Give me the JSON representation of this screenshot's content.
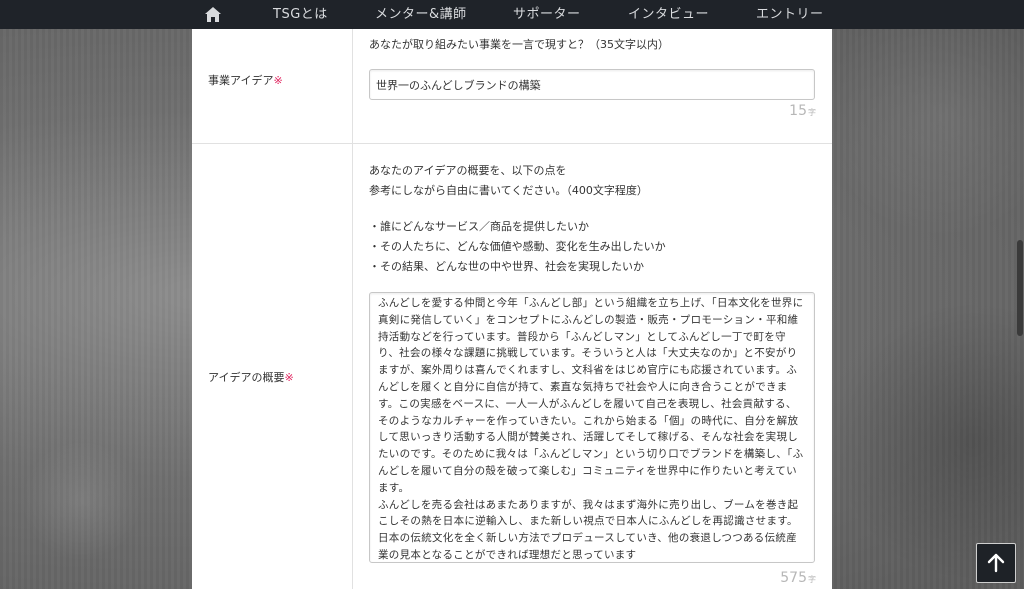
{
  "nav": {
    "home_icon": "home-icon",
    "items": [
      "TSGとは",
      "メンター&講師",
      "サポーター",
      "インタビュー",
      "エントリー"
    ]
  },
  "form": {
    "business_idea": {
      "label": "事業アイデア",
      "required_mark": "※",
      "instruction": "あなたが取り組みたい事業を一言で現すと？（35文字以内）",
      "value": "世界一のふんどしブランドの構築",
      "count": "15",
      "count_unit": "字"
    },
    "idea_summary": {
      "label": "アイデアの概要",
      "required_mark": "※",
      "instruction_lines": [
        "あなたのアイデアの概要を、以下の点を",
        "参考にしながら自由に書いてください。（400文字程度）",
        "・誰にどんなサービス／商品を提供したいか",
        "・その人たちに、どんな価値や感動、変化を生み出したいか",
        "・その結果、どんな世の中や世界、社会を実現したいか"
      ],
      "value": "ふんどしを愛する仲間と今年「ふんどし部」という組織を立ち上げ、「日本文化を世界に真剣に発信していく」をコンセプトにふんどしの製造・販売・プロモーション・平和維持活動などを行っています。普段から「ふんどしマン」としてふんどし一丁で町を守り、社会の様々な課題に挑戦しています。そういうと人は「大丈夫なのか」と不安がりますが、案外周りは喜んでくれますし、文科省をはじめ官庁にも応援されています。ふんどしを履くと自分に自信が持て、素直な気持ちで社会や人に向き合うことができます。この実感をベースに、一人一人がふんどしを履いて自己を表現し、社会貢献する、そのようなカルチャーを作っていきたい。これから始まる「個」の時代に、自分を解放して思いっきり活動する人間が賛美され、活躍してそして稼げる、そんな社会を実現したいのです。そのために我々は「ふんどしマン」という切り口でブランドを構築し、「ふんどしを履いて自分の殻を破って楽しむ」コミュニティを世界中に作りたいと考えています。\nふんどしを売る会社はあまたありますが、我々はまず海外に売り出し、ブームを巻き起こしその熱を日本に逆輸入し、また新しい視点で日本人にふんどしを再認識させます。日本の伝統文化を全く新しい方法でプロデュースしていき、他の衰退しつつある伝統産業の見本となることができれば理想だと思っています",
      "count": "575",
      "count_unit": "字"
    }
  },
  "scroll_top_icon": "arrow-up-icon"
}
